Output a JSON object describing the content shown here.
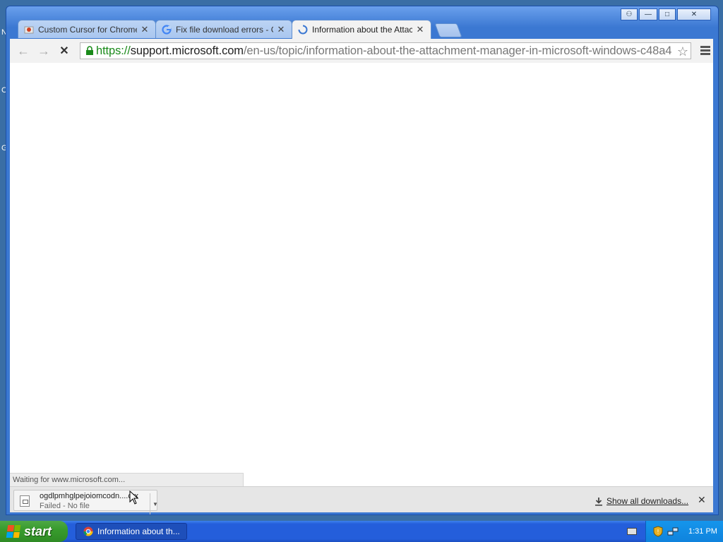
{
  "desktop": {
    "letters": [
      "N",
      "C",
      "G"
    ]
  },
  "window": {
    "controls": {
      "user": "⚇",
      "minimize": "—",
      "maximize": "□",
      "close": "✕"
    }
  },
  "tabs": [
    {
      "title": "Custom Cursor for Chrome™",
      "favicon": "custom-cursor-favicon",
      "close": "✕"
    },
    {
      "title": "Fix file download errors - Go",
      "favicon": "google-favicon",
      "close": "✕"
    },
    {
      "title": "Information about the Attach",
      "favicon": "loading-spinner",
      "close": "✕",
      "active": true
    }
  ],
  "toolbar": {
    "back": "←",
    "forward": "→",
    "stop": "✕",
    "url": {
      "scheme": "https://",
      "host": "support.microsoft.com",
      "path": "/en-us/topic/information-about-the-attachment-manager-in-microsoft-windows-c48a4"
    },
    "bookmark_star": "☆"
  },
  "status_bar": {
    "text": "Waiting for www.microsoft.com..."
  },
  "download_shelf": {
    "item": {
      "filename": "ogdlpmhglpejoiomcodn....crx",
      "status": "Failed - No file",
      "dropdown": "▼"
    },
    "show_all": "Show all downloads...",
    "close": "✕"
  },
  "taskbar": {
    "start_label": "start",
    "task_button": "Information about th...",
    "clock": "1:31 PM"
  },
  "colors": {
    "url_scheme": "#1a8a1a",
    "taskbar_blue": "#245edb",
    "start_green": "#389c2d"
  }
}
